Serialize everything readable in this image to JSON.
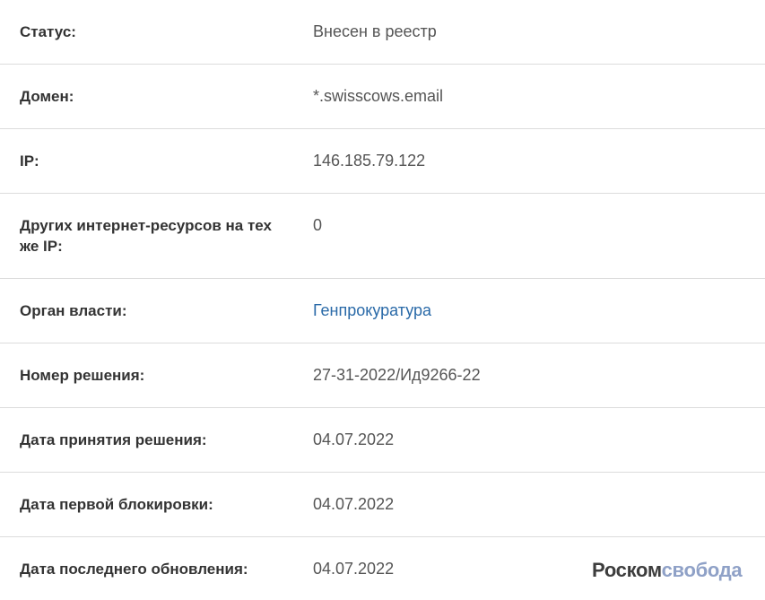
{
  "rows": [
    {
      "label": "Статус:",
      "value": "Внесен в реестр"
    },
    {
      "label": "Домен:",
      "value": "*.swisscows.email"
    },
    {
      "label": "IP:",
      "value": "146.185.79.122"
    },
    {
      "label": "Других интернет-ресурсов на тех же IP:",
      "value": "0"
    },
    {
      "label": "Орган власти:",
      "value": "Генпрокуратура"
    },
    {
      "label": "Номер решения:",
      "value": "27-31-2022/Ид9266-22"
    },
    {
      "label": "Дата принятия решения:",
      "value": "04.07.2022"
    },
    {
      "label": "Дата первой блокировки:",
      "value": "04.07.2022"
    },
    {
      "label": "Дата последнего обновления:",
      "value": "04.07.2022"
    }
  ],
  "watermark": {
    "part1": "Роском",
    "part2": "свобода"
  },
  "colors": {
    "label": "#333333",
    "value": "#555555",
    "link": "#2a6aa8",
    "divider": "#dcdcdc"
  }
}
